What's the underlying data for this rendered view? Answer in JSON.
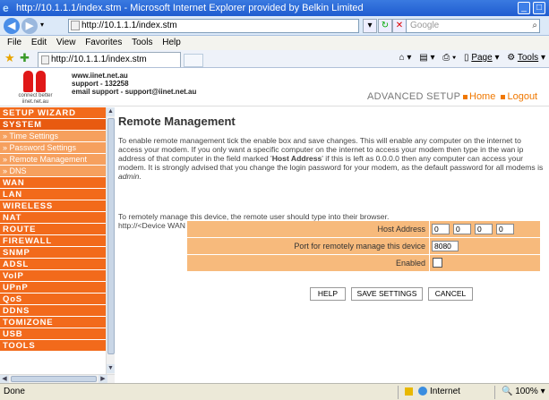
{
  "window": {
    "title": "http://10.1.1.1/index.stm - Microsoft Internet Explorer provided by Belkin Limited"
  },
  "address": {
    "url": "http://10.1.1.1/index.stm",
    "search_placeholder": "Google"
  },
  "menu": [
    "File",
    "Edit",
    "View",
    "Favorites",
    "Tools",
    "Help"
  ],
  "tab": {
    "label": "http://10.1.1.1/index.stm"
  },
  "toolbar": {
    "page": "Page",
    "tools": "Tools"
  },
  "header": {
    "logo_tagline": "connect better\niinet.net.au",
    "site": "www.iinet.net.au",
    "support_phone": "support - 132258",
    "support_email": "email support - support@iinet.net.au",
    "section": "ADVANCED SETUP",
    "home": "Home",
    "logout": "Logout"
  },
  "sidebar": {
    "items": [
      {
        "label": "SETUP WIZARD",
        "type": "main"
      },
      {
        "label": "SYSTEM",
        "type": "active"
      },
      {
        "label": "» Time Settings",
        "type": "sub"
      },
      {
        "label": "» Password Settings",
        "type": "sub"
      },
      {
        "label": "» Remote Management",
        "type": "sub"
      },
      {
        "label": "» DNS",
        "type": "sub"
      },
      {
        "label": "WAN",
        "type": "main"
      },
      {
        "label": "LAN",
        "type": "main"
      },
      {
        "label": "WIRELESS",
        "type": "main"
      },
      {
        "label": "NAT",
        "type": "main"
      },
      {
        "label": "ROUTE",
        "type": "main"
      },
      {
        "label": "FIREWALL",
        "type": "main"
      },
      {
        "label": "SNMP",
        "type": "main"
      },
      {
        "label": "ADSL",
        "type": "main"
      },
      {
        "label": "VoIP",
        "type": "main"
      },
      {
        "label": "UPnP",
        "type": "main"
      },
      {
        "label": "QoS",
        "type": "main"
      },
      {
        "label": "DDNS",
        "type": "main"
      },
      {
        "label": "TOMIZONE",
        "type": "main"
      },
      {
        "label": "USB",
        "type": "main"
      },
      {
        "label": "TOOLS",
        "type": "main"
      }
    ]
  },
  "main": {
    "title": "Remote Management",
    "intro_1": "To enable remote management tick the enable box and save changes. This will enable any computer on the internet to access your modem. If you only want a specific computer on the internet to access your modem then type in the wan ip address of that computer in the field marked '",
    "intro_bold": "Host Address",
    "intro_2": "' if this is left as 0.0.0.0 then any computer can access your modem. It is strongly advised that you change the login password for your modem, as the default password for all modems is ",
    "intro_italic": "admin",
    "intro_3": ".",
    "access_line_1": "To remotely manage this device, the remote user should type into their browser.",
    "access_line_2": "http://<Device WAN IP address>: 8080.",
    "form": {
      "host_label": "Host Address",
      "host_octets": [
        "0",
        "0",
        "0",
        "0"
      ],
      "port_label": "Port for remotely manage this device",
      "port_value": "8080",
      "enabled_label": "Enabled",
      "enabled": false
    },
    "buttons": {
      "help": "HELP",
      "save": "SAVE SETTINGS",
      "cancel": "CANCEL"
    }
  },
  "status": {
    "left": "Done",
    "zone": "Internet",
    "zoom": "100%"
  }
}
